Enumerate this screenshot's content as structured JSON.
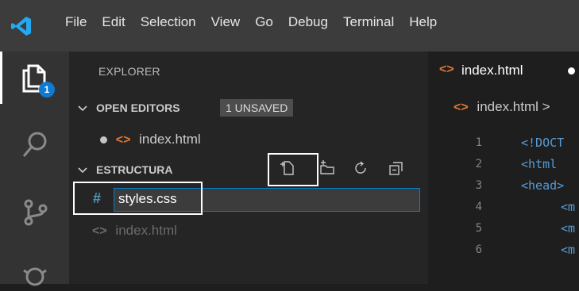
{
  "menu": {
    "items": [
      "File",
      "Edit",
      "Selection",
      "View",
      "Go",
      "Debug",
      "Terminal",
      "Help"
    ]
  },
  "activity": {
    "explorer_badge": "1"
  },
  "sidebar": {
    "title": "EXPLORER",
    "open_editors": {
      "header": "OPEN EDITORS",
      "badge": "1 UNSAVED",
      "files": [
        {
          "name": "index.html",
          "unsaved": true
        }
      ]
    },
    "folder": {
      "header": "ESTRUCTURA",
      "new_file_input": {
        "icon_text": "#",
        "value": "styles.css"
      },
      "files": [
        {
          "name": "index.html"
        }
      ]
    }
  },
  "editor": {
    "tab": {
      "label": "index.html",
      "unsaved": true
    },
    "breadcrumb": "index.html >",
    "lines": [
      {
        "num": "1",
        "code": "<!DOCT"
      },
      {
        "num": "2",
        "code": "<html"
      },
      {
        "num": "3",
        "code": "<head>"
      },
      {
        "num": "4",
        "code": "<m"
      },
      {
        "num": "5",
        "code": "<m"
      },
      {
        "num": "6",
        "code": "<m"
      }
    ]
  },
  "colors": {
    "accent": "#007fd4",
    "badge": "#0e7ad3",
    "html_icon": "#e37933",
    "keyword": "#569cd6"
  }
}
